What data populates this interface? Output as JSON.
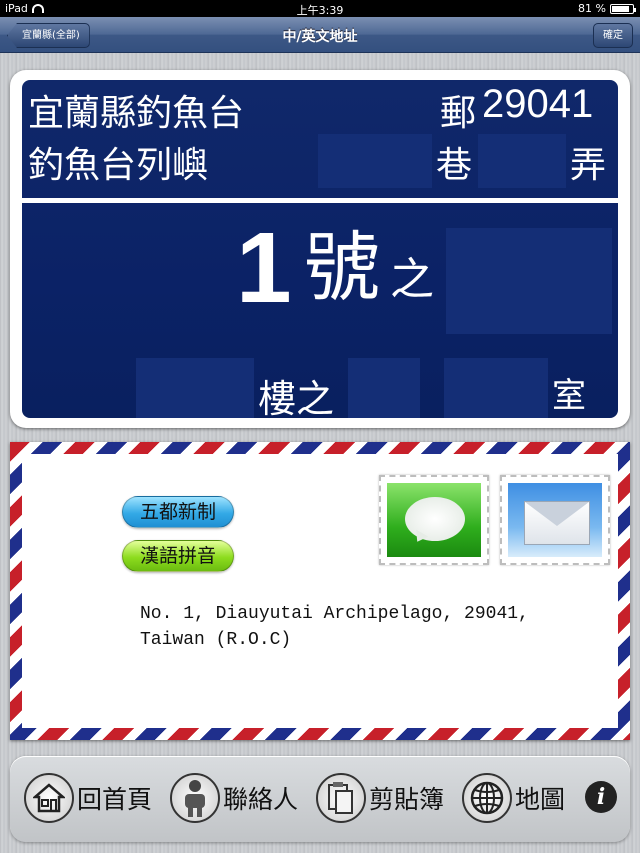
{
  "status_bar": {
    "device": "iPad",
    "time": "上午3:39",
    "battery": "81 %"
  },
  "nav": {
    "back_label": "宜蘭縣(全部)",
    "title": "中/英文地址",
    "ok_label": "確定"
  },
  "plate": {
    "county_town": "宜蘭縣釣魚台",
    "postal_prefix": "郵",
    "postal_code": "29041",
    "village_road": "釣魚台列嶼",
    "lane_label": "巷",
    "alley_label": "弄",
    "number": "1",
    "number_unit": "號",
    "sub_label": "之",
    "floor_label": "樓之",
    "room_label": "室"
  },
  "envelope": {
    "format_button": "五都新制",
    "pinyin_button": "漢語拼音",
    "english_line1": "No. 1, Diauyutai Archipelago,  29041,",
    "english_line2": "Taiwan   (R.O.C)",
    "sms_icon": "speech-bubble-icon",
    "mail_icon": "envelope-icon"
  },
  "toolbar": {
    "home_label": "回首頁",
    "contacts_label": "聯絡人",
    "clipboard_label": "剪貼簿",
    "map_label": "地圖",
    "info_label": "i"
  },
  "colors": {
    "plate_blue": "#0f2a6b",
    "nav_blue": "#3d5886",
    "stripe_red": "#c7202a",
    "stripe_blue": "#1f2f8c"
  }
}
